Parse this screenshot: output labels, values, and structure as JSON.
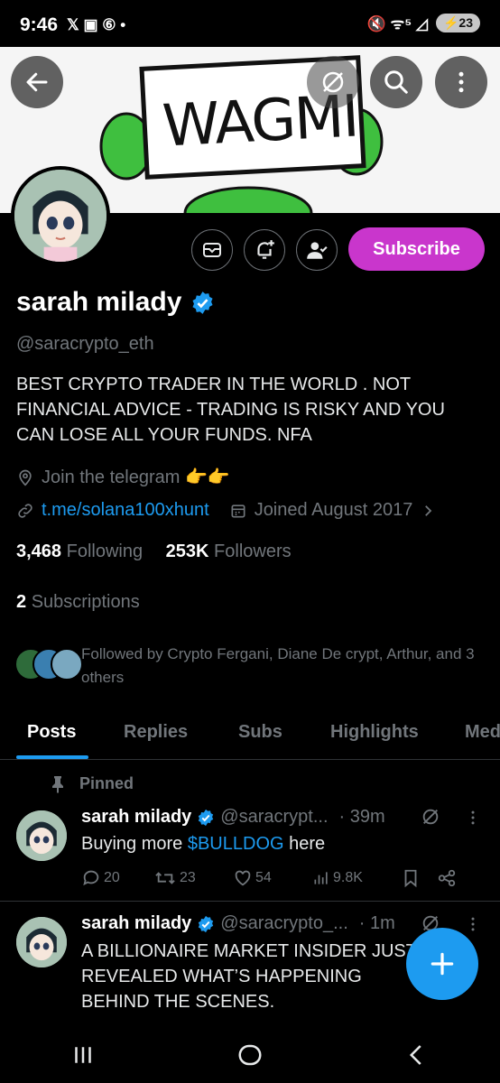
{
  "status": {
    "time": "9:46",
    "left_icons": "𝕏 ▣ ⑥ •",
    "right_icons": "🔇 ᯤ⁵ ◿",
    "battery": "23"
  },
  "banner": {
    "text": "WAGMI"
  },
  "profile": {
    "subscribe_label": "Subscribe",
    "name": "sarah milady",
    "handle": "@saracrypto_eth",
    "bio": "BEST CRYPTO TRADER IN THE WORLD . NOT FINANCIAL ADVICE - TRADING IS RISKY AND YOU CAN LOSE ALL YOUR FUNDS. NFA",
    "location": "Join the telegram 👉👉",
    "website": "t.me/solana100xhunt",
    "joined": "Joined August 2017",
    "following_count": "3,468",
    "following_label": "Following",
    "followers_count": "253K",
    "followers_label": "Followers",
    "subscriptions_count": "2",
    "subscriptions_label": "Subscriptions",
    "followed_by": "Followed by Crypto Fergani, Diane De crypt, Arthur, and 3 others"
  },
  "tabs": [
    "Posts",
    "Replies",
    "Subs",
    "Highlights",
    "Med"
  ],
  "posts": [
    {
      "pinned_label": "Pinned",
      "name": "sarah milady",
      "handle": "@saracrypt...",
      "time": "· 39m",
      "text_before": "Buying more ",
      "cashtag": "$BULLDOG",
      "text_after": " here",
      "replies": "20",
      "reposts": "23",
      "likes": "54",
      "views": "9.8K"
    },
    {
      "name": "sarah milady",
      "handle": "@saracrypto_...",
      "time": "· 1m",
      "text": "A BILLIONAIRE MARKET INSIDER JUST REVEALED WHAT’S HAPPENING BEHIND THE SCENES."
    }
  ],
  "colors": {
    "accent": "#1d9bf0",
    "subscribe": "#c936cc",
    "background": "#000000"
  }
}
